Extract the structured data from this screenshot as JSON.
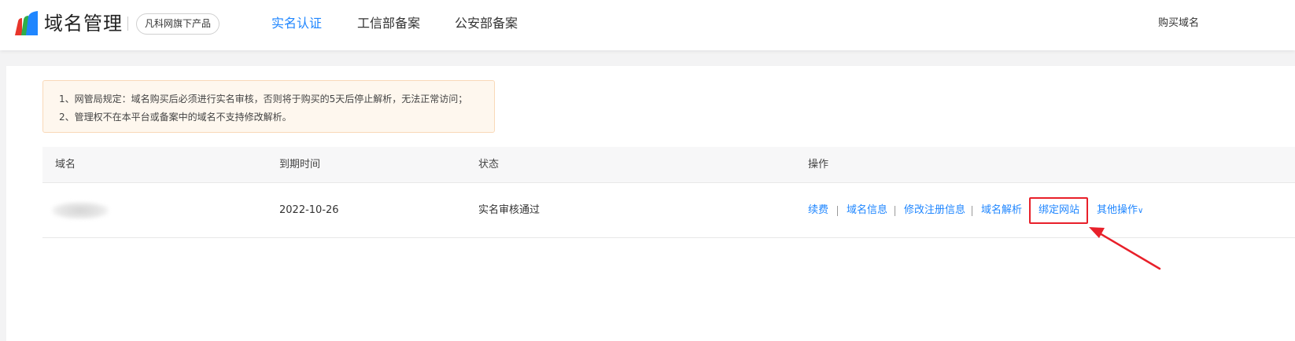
{
  "header": {
    "brand": "域名管理",
    "badge": "凡科网旗下产品",
    "tabs": [
      {
        "label": "实名认证",
        "active": true
      },
      {
        "label": "工信部备案",
        "active": false
      },
      {
        "label": "公安部备案",
        "active": false
      }
    ],
    "buy_domain": "购买域名"
  },
  "notice": {
    "lines": [
      "1、网管局规定：域名购买后必须进行实名审核，否则将于购买的5天后停止解析，无法正常访问；",
      "2、管理权不在本平台或备案中的域名不支持修改解析。"
    ]
  },
  "table": {
    "headers": {
      "domain": "域名",
      "expiry": "到期时间",
      "status": "状态",
      "actions": "操作"
    },
    "rows": [
      {
        "expiry": "2022-10-26",
        "status": "实名审核通过",
        "actions": {
          "renew": "续费",
          "info": "域名信息",
          "edit_reg": "修改注册信息",
          "dns": "域名解析",
          "bind_site": "绑定网站",
          "more": "其他操作"
        }
      }
    ]
  },
  "colors": {
    "accent": "#1f86ff",
    "annotation": "#e8202a"
  }
}
